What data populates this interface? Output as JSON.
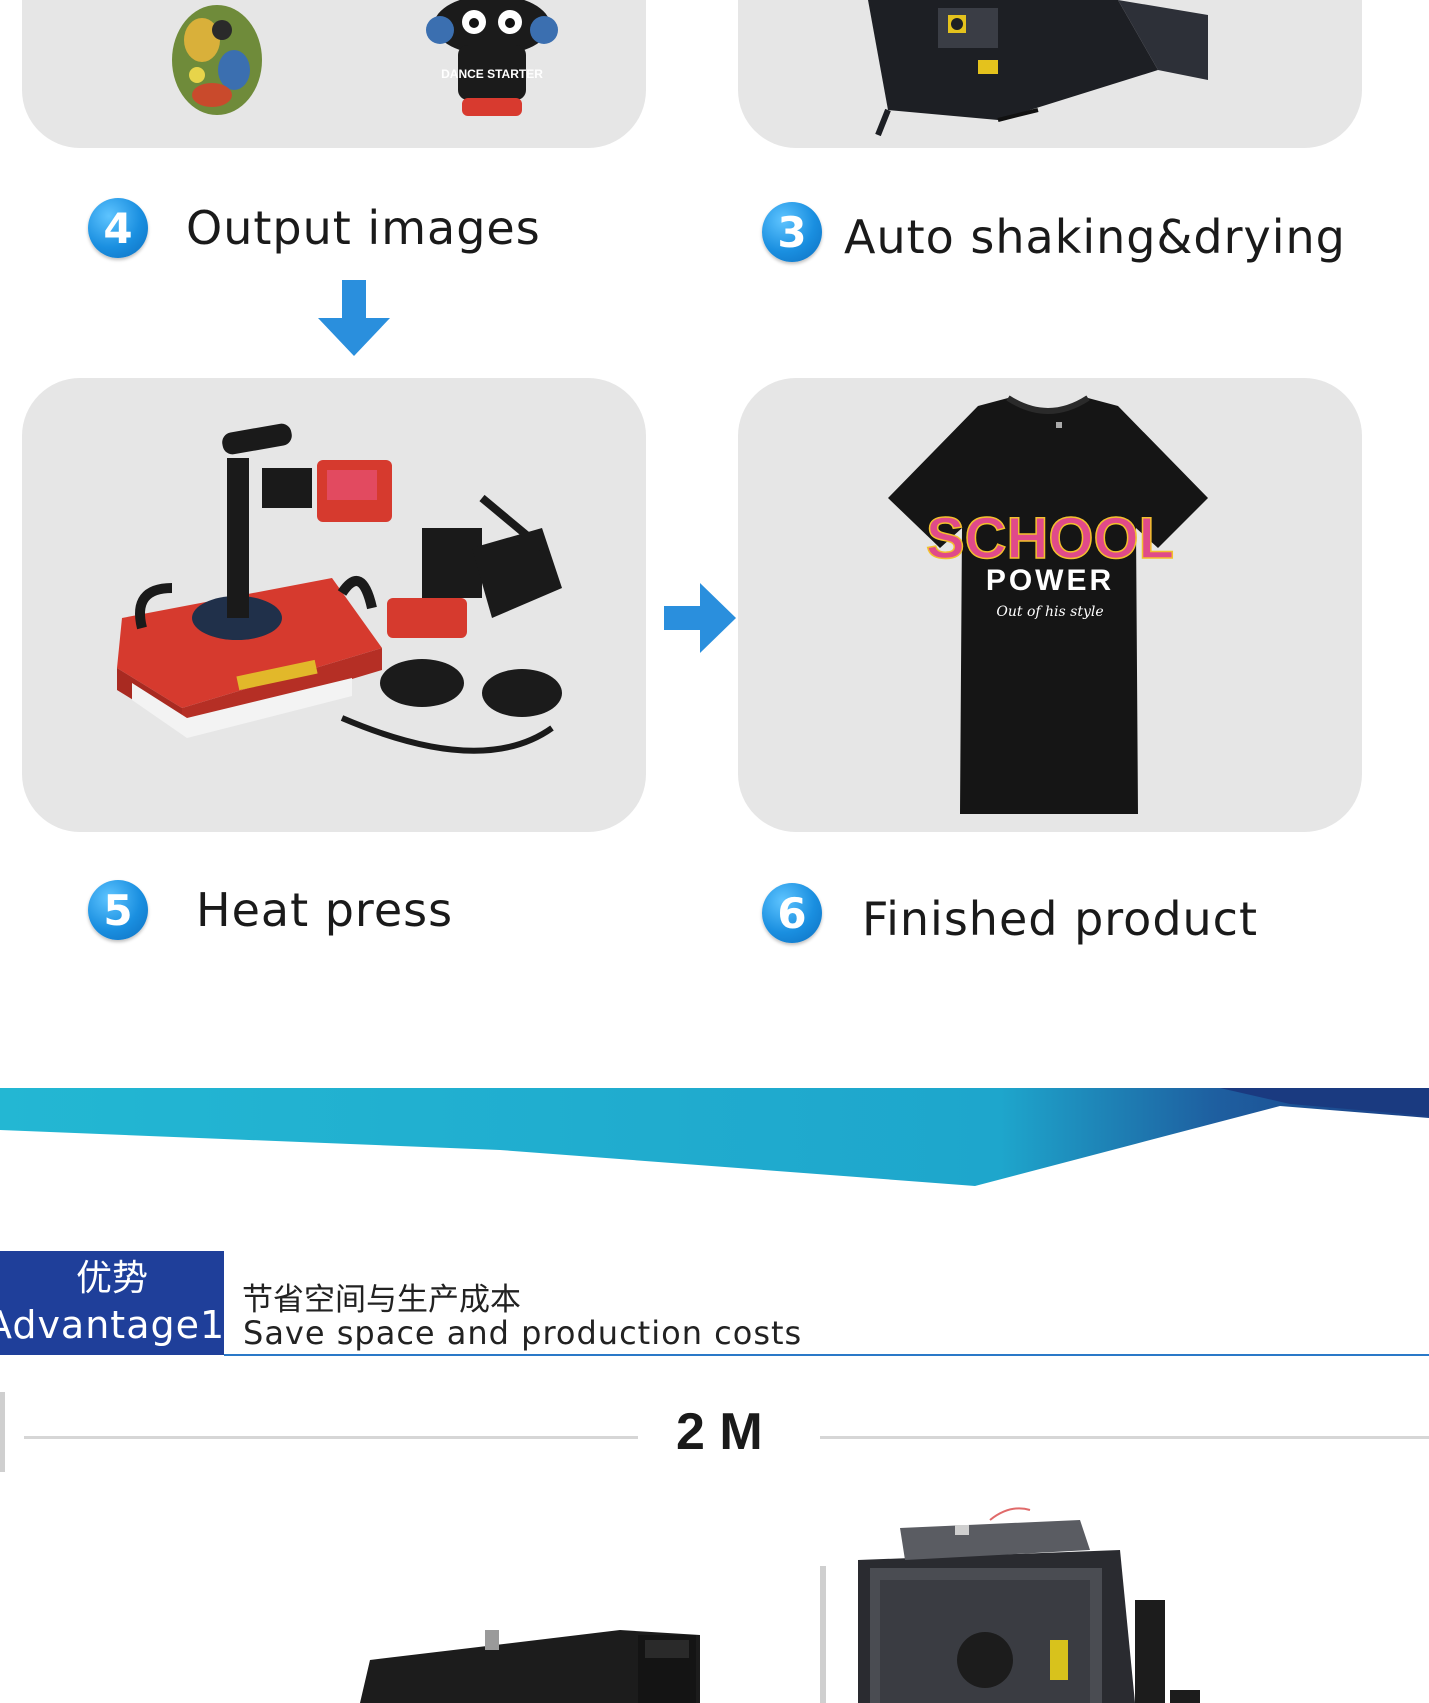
{
  "steps": {
    "step4": {
      "number": "4",
      "label": "Output images"
    },
    "step3": {
      "number": "3",
      "label": "Auto shaking&drying"
    },
    "step5": {
      "number": "5",
      "label": "Heat press"
    },
    "step6": {
      "number": "6",
      "label": "Finished product"
    }
  },
  "images": {
    "sticker_text": "DANCE STARTER",
    "shirt_line1": "SCHOOL",
    "shirt_line2": "POWER",
    "shirt_script": "Out of his style"
  },
  "advantage": {
    "label_zh": "优势",
    "label_en": "Advantage1",
    "title_zh": "节省空间与生产成本",
    "title_en": "Save space and production costs"
  },
  "dimension": {
    "text": "2 M"
  },
  "colors": {
    "accent_blue": "#1a8fe0",
    "banner_navy": "#1f3f9a",
    "banner_teal": "#1fb2cf",
    "panel_gray": "#e6e6e6"
  }
}
